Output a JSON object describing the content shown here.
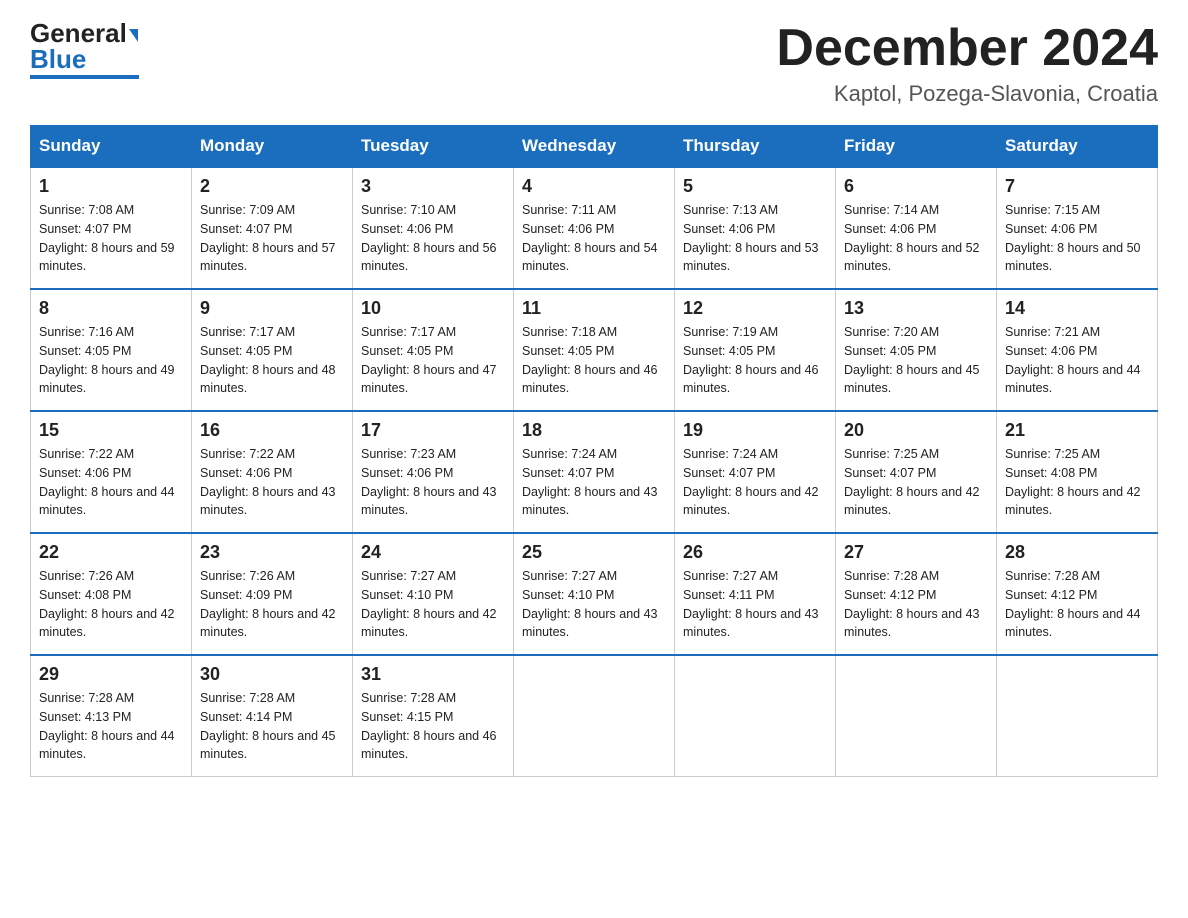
{
  "logo": {
    "text_general": "General",
    "text_blue": "Blue"
  },
  "title": {
    "month": "December 2024",
    "location": "Kaptol, Pozega-Slavonia, Croatia"
  },
  "weekdays": [
    "Sunday",
    "Monday",
    "Tuesday",
    "Wednesday",
    "Thursday",
    "Friday",
    "Saturday"
  ],
  "weeks": [
    [
      {
        "day": "1",
        "sunrise": "7:08 AM",
        "sunset": "4:07 PM",
        "daylight": "8 hours and 59 minutes."
      },
      {
        "day": "2",
        "sunrise": "7:09 AM",
        "sunset": "4:07 PM",
        "daylight": "8 hours and 57 minutes."
      },
      {
        "day": "3",
        "sunrise": "7:10 AM",
        "sunset": "4:06 PM",
        "daylight": "8 hours and 56 minutes."
      },
      {
        "day": "4",
        "sunrise": "7:11 AM",
        "sunset": "4:06 PM",
        "daylight": "8 hours and 54 minutes."
      },
      {
        "day": "5",
        "sunrise": "7:13 AM",
        "sunset": "4:06 PM",
        "daylight": "8 hours and 53 minutes."
      },
      {
        "day": "6",
        "sunrise": "7:14 AM",
        "sunset": "4:06 PM",
        "daylight": "8 hours and 52 minutes."
      },
      {
        "day": "7",
        "sunrise": "7:15 AM",
        "sunset": "4:06 PM",
        "daylight": "8 hours and 50 minutes."
      }
    ],
    [
      {
        "day": "8",
        "sunrise": "7:16 AM",
        "sunset": "4:05 PM",
        "daylight": "8 hours and 49 minutes."
      },
      {
        "day": "9",
        "sunrise": "7:17 AM",
        "sunset": "4:05 PM",
        "daylight": "8 hours and 48 minutes."
      },
      {
        "day": "10",
        "sunrise": "7:17 AM",
        "sunset": "4:05 PM",
        "daylight": "8 hours and 47 minutes."
      },
      {
        "day": "11",
        "sunrise": "7:18 AM",
        "sunset": "4:05 PM",
        "daylight": "8 hours and 46 minutes."
      },
      {
        "day": "12",
        "sunrise": "7:19 AM",
        "sunset": "4:05 PM",
        "daylight": "8 hours and 46 minutes."
      },
      {
        "day": "13",
        "sunrise": "7:20 AM",
        "sunset": "4:05 PM",
        "daylight": "8 hours and 45 minutes."
      },
      {
        "day": "14",
        "sunrise": "7:21 AM",
        "sunset": "4:06 PM",
        "daylight": "8 hours and 44 minutes."
      }
    ],
    [
      {
        "day": "15",
        "sunrise": "7:22 AM",
        "sunset": "4:06 PM",
        "daylight": "8 hours and 44 minutes."
      },
      {
        "day": "16",
        "sunrise": "7:22 AM",
        "sunset": "4:06 PM",
        "daylight": "8 hours and 43 minutes."
      },
      {
        "day": "17",
        "sunrise": "7:23 AM",
        "sunset": "4:06 PM",
        "daylight": "8 hours and 43 minutes."
      },
      {
        "day": "18",
        "sunrise": "7:24 AM",
        "sunset": "4:07 PM",
        "daylight": "8 hours and 43 minutes."
      },
      {
        "day": "19",
        "sunrise": "7:24 AM",
        "sunset": "4:07 PM",
        "daylight": "8 hours and 42 minutes."
      },
      {
        "day": "20",
        "sunrise": "7:25 AM",
        "sunset": "4:07 PM",
        "daylight": "8 hours and 42 minutes."
      },
      {
        "day": "21",
        "sunrise": "7:25 AM",
        "sunset": "4:08 PM",
        "daylight": "8 hours and 42 minutes."
      }
    ],
    [
      {
        "day": "22",
        "sunrise": "7:26 AM",
        "sunset": "4:08 PM",
        "daylight": "8 hours and 42 minutes."
      },
      {
        "day": "23",
        "sunrise": "7:26 AM",
        "sunset": "4:09 PM",
        "daylight": "8 hours and 42 minutes."
      },
      {
        "day": "24",
        "sunrise": "7:27 AM",
        "sunset": "4:10 PM",
        "daylight": "8 hours and 42 minutes."
      },
      {
        "day": "25",
        "sunrise": "7:27 AM",
        "sunset": "4:10 PM",
        "daylight": "8 hours and 43 minutes."
      },
      {
        "day": "26",
        "sunrise": "7:27 AM",
        "sunset": "4:11 PM",
        "daylight": "8 hours and 43 minutes."
      },
      {
        "day": "27",
        "sunrise": "7:28 AM",
        "sunset": "4:12 PM",
        "daylight": "8 hours and 43 minutes."
      },
      {
        "day": "28",
        "sunrise": "7:28 AM",
        "sunset": "4:12 PM",
        "daylight": "8 hours and 44 minutes."
      }
    ],
    [
      {
        "day": "29",
        "sunrise": "7:28 AM",
        "sunset": "4:13 PM",
        "daylight": "8 hours and 44 minutes."
      },
      {
        "day": "30",
        "sunrise": "7:28 AM",
        "sunset": "4:14 PM",
        "daylight": "8 hours and 45 minutes."
      },
      {
        "day": "31",
        "sunrise": "7:28 AM",
        "sunset": "4:15 PM",
        "daylight": "8 hours and 46 minutes."
      },
      null,
      null,
      null,
      null
    ]
  ]
}
